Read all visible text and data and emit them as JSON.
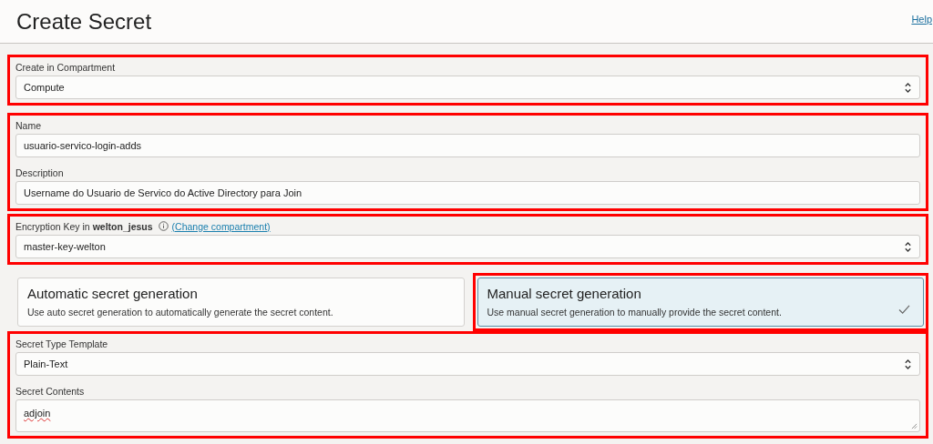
{
  "header": {
    "title": "Create Secret",
    "help_link": "Help"
  },
  "sections": [
    {
      "kind": "fields",
      "highlighted": true,
      "fields": [
        {
          "kind": "select",
          "label": "Create in Compartment",
          "value": "Compute"
        }
      ]
    },
    {
      "kind": "fields",
      "highlighted": true,
      "fields": [
        {
          "kind": "text",
          "label": "Name",
          "value": "usuario-servico-login-adds"
        },
        {
          "kind": "text",
          "label": "Description",
          "value": "Username do Usuario de Servico do Active Directory para Join"
        }
      ]
    },
    {
      "kind": "fields",
      "highlighted": true,
      "fields": [
        {
          "kind": "select",
          "label": "Encryption Key in **welton_jesus**",
          "info": true,
          "link": "(Change compartment)",
          "value": "master-key-welton"
        }
      ]
    },
    {
      "kind": "choice",
      "options": [
        {
          "title": "Automatic secret generation",
          "description": "Use auto secret generation to automatically generate the secret content.",
          "selected": false,
          "highlighted": false
        },
        {
          "title": "Manual secret generation",
          "description": "Use manual secret generation to manually provide the secret content.",
          "selected": true,
          "highlighted": true
        }
      ]
    },
    {
      "kind": "fields",
      "highlighted": true,
      "fields": [
        {
          "kind": "select",
          "label": "Secret Type Template",
          "value": "Plain-Text"
        },
        {
          "kind": "textarea",
          "label": "Secret Contents",
          "value": "adjoin"
        }
      ]
    }
  ]
}
